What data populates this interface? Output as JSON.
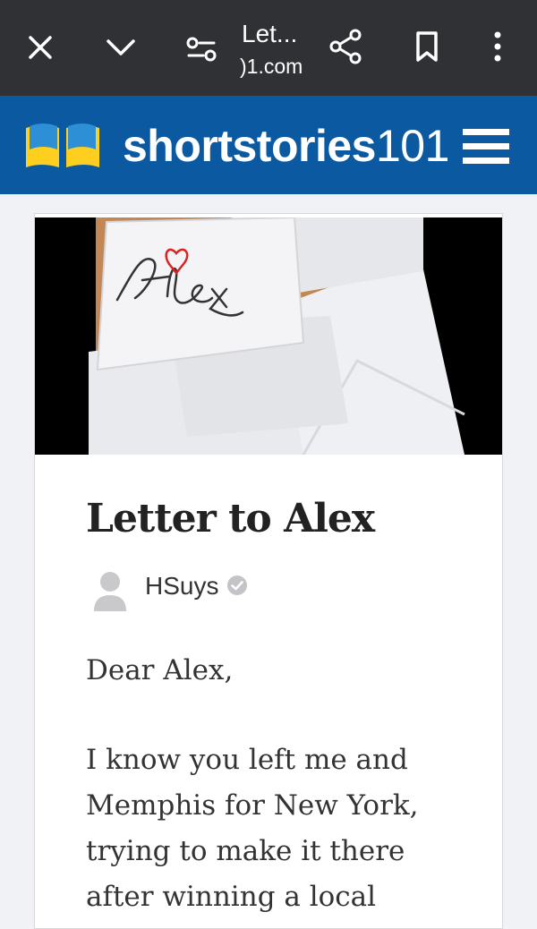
{
  "browser": {
    "tab_title": "Let...",
    "url_fragment": ")1.com"
  },
  "site": {
    "logo_bold": "shortstories",
    "logo_num": "101",
    "accent": "#0b5aa1"
  },
  "article": {
    "hero_text": "Alex",
    "title": "Letter to Alex",
    "author": "HSuys",
    "paragraphs": [
      "Dear Alex,",
      "I know you left me and",
      "Memphis for New York,",
      "trying to make it there",
      "after winning a local"
    ]
  }
}
